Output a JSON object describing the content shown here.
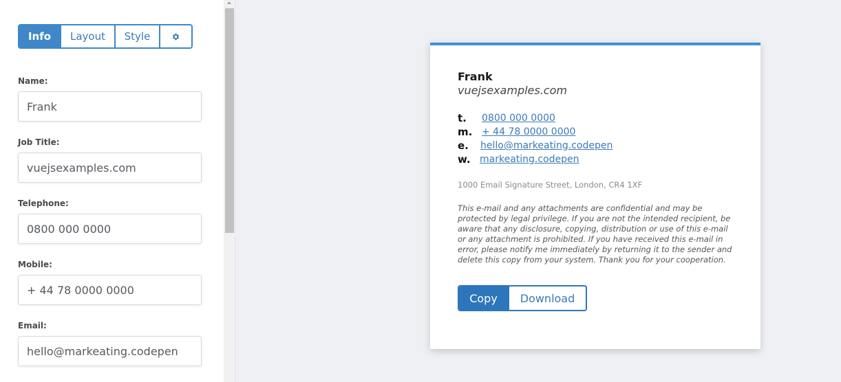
{
  "tabs": {
    "info": "Info",
    "layout": "Layout",
    "style": "Style",
    "settings_icon": "gear-icon"
  },
  "form": {
    "name": {
      "label": "Name:",
      "value": "Frank"
    },
    "job_title": {
      "label": "Job Title:",
      "value": "vuejsexamples.com"
    },
    "telephone": {
      "label": "Telephone:",
      "value": "0800 000 0000"
    },
    "mobile": {
      "label": "Mobile:",
      "value": "+ 44 78 0000 0000"
    },
    "email": {
      "label": "Email:",
      "value": "hello@markeating.codepen"
    }
  },
  "signature": {
    "name": "Frank",
    "title": "vuejsexamples.com",
    "contacts": [
      {
        "key": "t.",
        "value": "0800 000 0000"
      },
      {
        "key": "m.",
        "value": "+ 44 78 0000 0000"
      },
      {
        "key": "e.",
        "value": "hello@markeating.codepen"
      },
      {
        "key": "w.",
        "value": "markeating.codepen"
      }
    ],
    "address": "1000 Email Signature Street, London, CR4 1XF",
    "disclaimer": "This e-mail and any attachments are confidential and may be protected by legal privilege. If you are not the intended recipient, be aware that any disclosure, copying, distribution or use of this e-mail or any attachment is prohibited. If you have received this e-mail in error, please notify me immediately by returning it to the sender and delete this copy from your system. Thank you for your cooperation."
  },
  "actions": {
    "copy": "Copy",
    "download": "Download"
  },
  "colors": {
    "accent": "#3f87c8",
    "link": "#3a7ab9",
    "card_top_border": "#3f8fd8"
  }
}
